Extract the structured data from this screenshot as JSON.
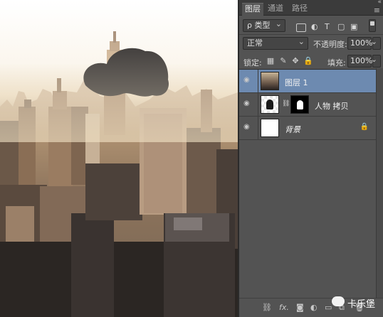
{
  "tabs": [
    "图层",
    "通道",
    "路径"
  ],
  "filter": {
    "kind_label": "ρ 类型"
  },
  "blend": {
    "mode": "正常",
    "opacity_label": "不透明度:",
    "opacity_value": "100%"
  },
  "lock": {
    "label": "锁定:",
    "fill_label": "填充:",
    "fill_value": "100%"
  },
  "layers": [
    {
      "name": "图层 1"
    },
    {
      "name": "人物 拷贝"
    },
    {
      "name": "背景"
    }
  ],
  "footer": {
    "fx_label": "fx."
  },
  "watermark": {
    "text": "卡乐堡"
  },
  "colors": {
    "selection": "#6d8ab0",
    "panel": "#535353"
  }
}
